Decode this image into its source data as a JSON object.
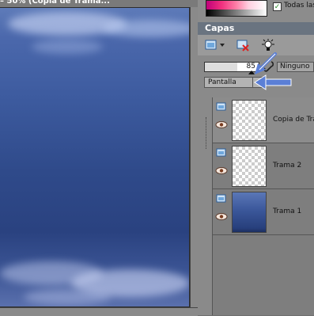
{
  "image_window": {
    "title": "– 50% (Copia de Trama..."
  },
  "top": {
    "todas_label": "Todas las",
    "todas_checked": "✓"
  },
  "layers_panel": {
    "title": "Capas",
    "opacity_value": "85",
    "link_label": "Ninguno",
    "blend_mode": "Pantalla",
    "layers": [
      {
        "name": "Copia de Tra",
        "thumb": "transparent"
      },
      {
        "name": "Trama 2",
        "thumb": "transparent"
      },
      {
        "name": "Trama 1",
        "thumb": "blue"
      }
    ]
  },
  "colors": {
    "panel_bg": "#8a8a8a",
    "title_bar": "#6a7480",
    "arrow_blue": "#5b7fd6"
  },
  "icons": [
    "new-layer-icon",
    "delete-layer-icon",
    "mask-icon",
    "link-icon",
    "layer-type-icon",
    "eye-icon"
  ]
}
